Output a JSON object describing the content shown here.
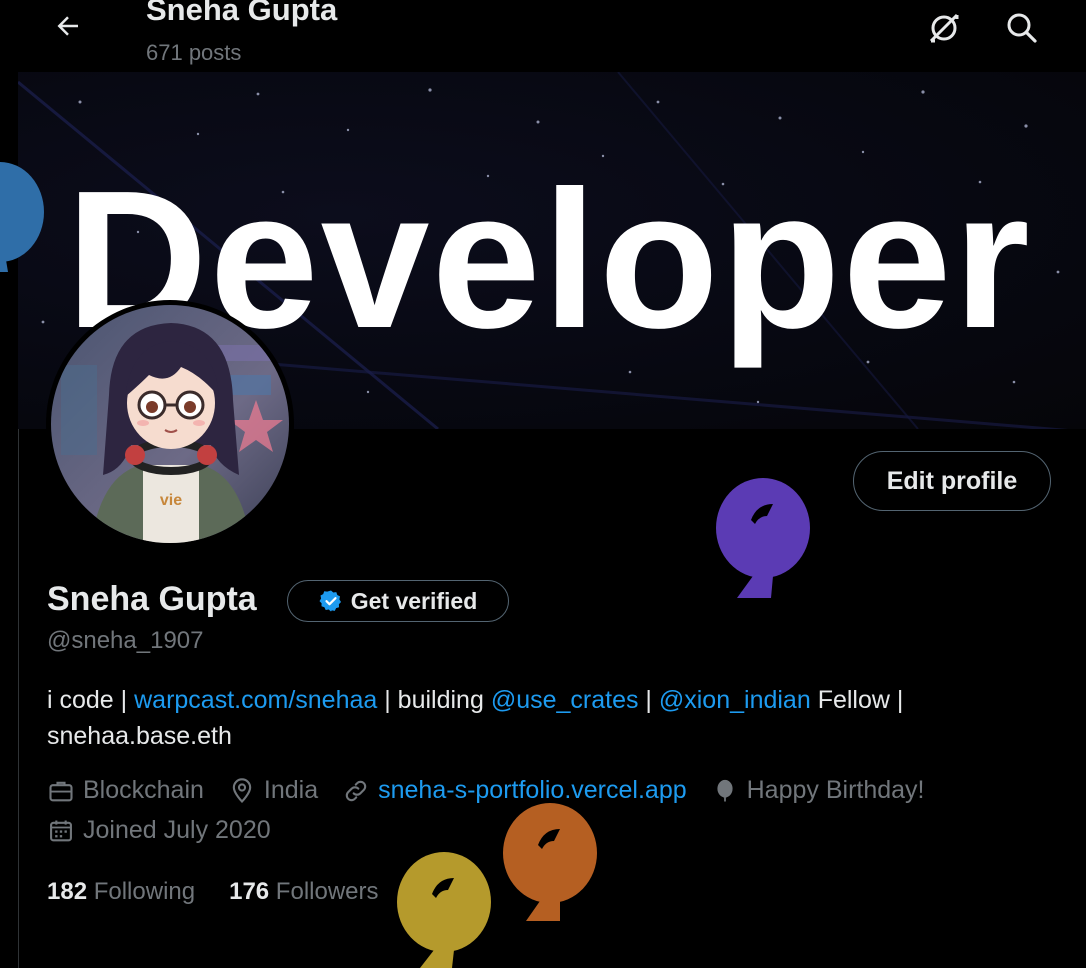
{
  "header": {
    "name": "Sneha Gupta",
    "posts": "671 posts"
  },
  "banner": {
    "text": "Developer"
  },
  "profile": {
    "display_name": "Sneha Gupta",
    "verify_label": "Get verified",
    "handle": "@sneha_1907",
    "edit_label": "Edit profile"
  },
  "bio": {
    "t1": "i code | ",
    "link1": "warpcast.com/snehaa",
    "t2": " | building ",
    "link2": "@use_crates",
    "t3": " | ",
    "link3": "@xion_indian",
    "t4": " Fellow | snehaa.base.eth"
  },
  "meta": {
    "category": "Blockchain",
    "location": "India",
    "website": "sneha-s-portfolio.vercel.app",
    "birthday": "Happy Birthday!",
    "joined": "Joined July 2020"
  },
  "stats": {
    "following_count": "182",
    "following_label": " Following",
    "followers_count": "176",
    "followers_label": " Followers"
  },
  "colors": {
    "accent": "#1d9bf0",
    "balloon_blue": "#2f6ea8",
    "balloon_purple": "#5b3bb4",
    "balloon_orange": "#b55f22",
    "balloon_gold": "#b59a2c"
  }
}
